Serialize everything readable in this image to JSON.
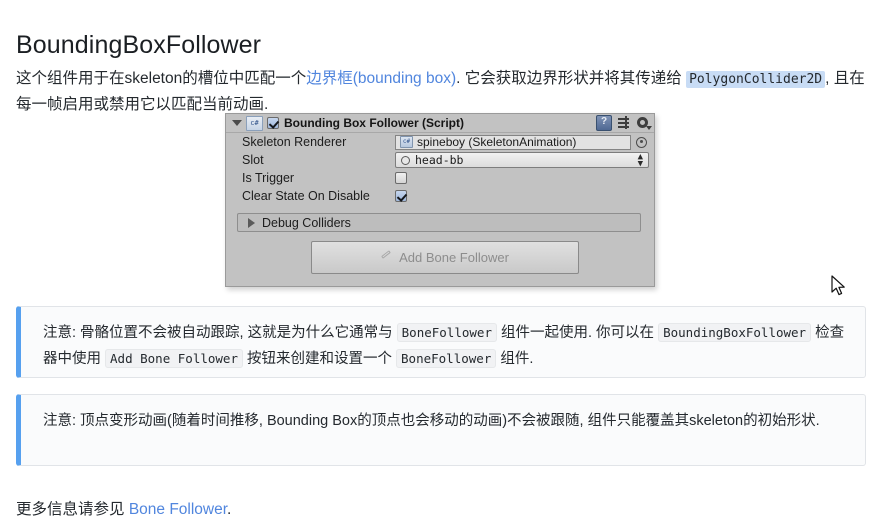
{
  "page": {
    "title": "BoundingBoxFollower"
  },
  "intro": {
    "part1": "这个组件用于在skeleton的槽位中匹配一个",
    "link_text": "边界框(bounding box)",
    "part2": ". 它会获取边界形状并将其传递给 ",
    "code": "PolygonCollider2D",
    "part3": ", 且在每一帧启用或禁用它以匹配当前动画."
  },
  "inspector": {
    "component_title": "Bounding Box Follower (Script)",
    "enabled_checkbox": true,
    "script_icon_label": "c#",
    "icons": {
      "foldout": "triangle-down-icon",
      "help": "help-icon",
      "preset": "preset-icon",
      "gear": "gear-icon"
    },
    "properties": [
      {
        "label": "Skeleton Renderer",
        "value": "spineboy (SkeletonAnimation)",
        "type": "object-field"
      },
      {
        "label": "Slot",
        "value": "head-bb",
        "type": "popup-field"
      },
      {
        "label": "Is Trigger",
        "value": false,
        "type": "checkbox"
      },
      {
        "label": "Clear State On Disable",
        "value": true,
        "type": "checkbox"
      }
    ],
    "debug_foldout": "Debug Colliders",
    "add_bone_follower_button": "Add Bone Follower"
  },
  "notes": [
    {
      "seg1": "注意: 骨骼位置不会被自动跟踪, 这就是为什么它通常与 ",
      "code1": "BoneFollower",
      "seg2": " 组件一起使用. 你可以在 ",
      "code2": "BoundingBoxFollower",
      "seg3": " 检查器中使用 ",
      "code3": "Add Bone Follower",
      "seg4": " 按钮来创建和设置一个 ",
      "code4": "BoneFollower",
      "seg5": " 组件."
    },
    {
      "seg1": "注意: 顶点变形动画(随着时间推移, Bounding Box的顶点也会移动的动画)不会被跟随, 组件只能覆盖其skeleton的初始形状."
    }
  ],
  "footer": {
    "prefix": "更多信息请参见 ",
    "link_text": "Bone Follower",
    "suffix": "."
  },
  "colors": {
    "link": "#5186de",
    "note_accent": "#56a0ef",
    "code_highlight": "#c8dcf5",
    "inspector_bg": "#c2c2c2"
  }
}
